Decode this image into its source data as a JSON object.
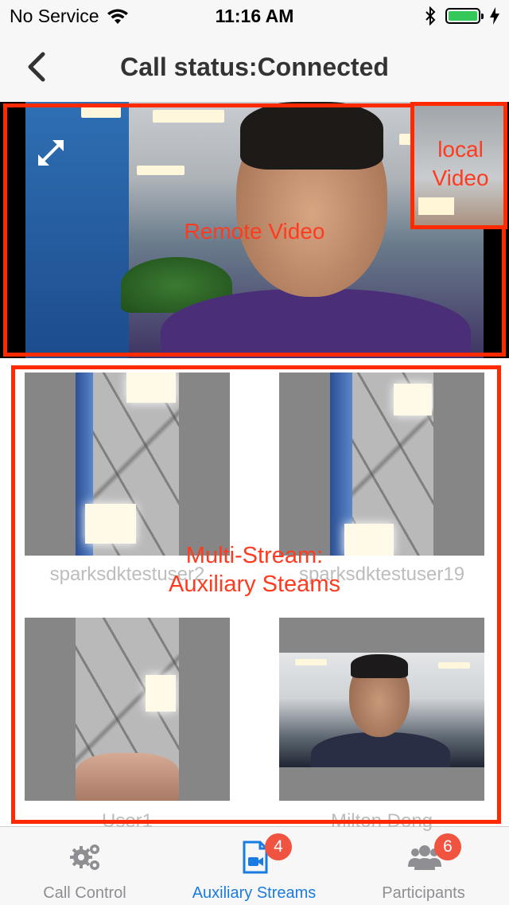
{
  "status_bar": {
    "carrier": "No Service",
    "time": "11:16 AM",
    "icons": [
      "wifi-icon",
      "bluetooth-icon",
      "battery-icon",
      "charging-bolt-icon"
    ],
    "battery_level": 1.0,
    "battery_color": "#34c759"
  },
  "nav": {
    "back_icon": "chevron-left-icon",
    "title": "Call status:Connected"
  },
  "remote_video": {
    "caption": "Remote Video",
    "expand_icon": "expand-arrows-icon"
  },
  "local_video": {
    "caption_line1": "local",
    "caption_line2": "Video"
  },
  "aux_streams": {
    "caption_line1": "Multi-Stream:",
    "caption_line2": "Auxiliary Steams",
    "tiles": [
      {
        "name": "sparksdktestuser2"
      },
      {
        "name": "sparksdktestuser19"
      },
      {
        "name": "User1"
      },
      {
        "name": "Milton Dong"
      }
    ]
  },
  "tabs": [
    {
      "label": "Call Control",
      "icon": "gears-icon",
      "active": false
    },
    {
      "label": "Auxiliary Streams",
      "icon": "video-doc-icon",
      "active": true,
      "badge": "4"
    },
    {
      "label": "Participants",
      "icon": "people-icon",
      "active": false,
      "badge": "6"
    }
  ],
  "colors": {
    "annotation_red": "#ff2a00",
    "active_tab": "#1a7be3",
    "inactive_tab": "#8e8e93",
    "badge": "#f0533f"
  }
}
